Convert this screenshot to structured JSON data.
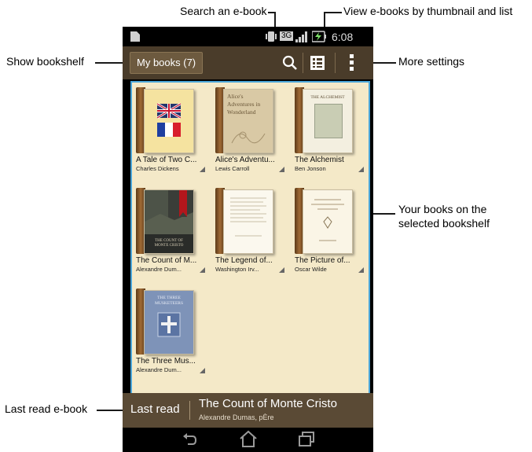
{
  "callouts": {
    "search": "Search an e-book",
    "view": "View e-books by thumbnail and list",
    "bookshelf": "Show bookshelf",
    "more": "More settings",
    "yourbooks_1": "Your books on the",
    "yourbooks_2": "selected bookshelf",
    "lastread": "Last read e-book"
  },
  "status": {
    "time": "6:08",
    "network": "3G"
  },
  "appbar": {
    "mybooks_label": "My books (7)"
  },
  "books": [
    {
      "title": "A Tale of Two C...",
      "author": "Charles Dickens"
    },
    {
      "title": "Alice's Adventu...",
      "author": "Lewis Carroll",
      "cover_text": "Alice's Adventures in Wonderland"
    },
    {
      "title": "The Alchemist",
      "author": "Ben Jonson",
      "cover_text": "THE ALCHEMIST"
    },
    {
      "title": "The Count of M...",
      "author": "Alexandre Dum...",
      "cover_text": "THE COUNT OF MONTE CRISTO"
    },
    {
      "title": "The Legend of...",
      "author": "Washington Irv..."
    },
    {
      "title": "The Picture of...",
      "author": "Oscar Wilde"
    },
    {
      "title": "The Three Mus...",
      "author": "Alexandre Dum...",
      "cover_text": "THE THREE MUSKETEERS"
    }
  ],
  "lastread": {
    "label": "Last read",
    "title": "The Count of Monte Cristo",
    "author": "Alexandre Dumas, pÈre"
  },
  "colors": {
    "appbar": "#4a3c2a",
    "shelf": "#f4e9c8",
    "selection": "#4aa6d9",
    "lastread": "#5a4a35"
  },
  "icons": [
    "search-icon",
    "list-view-icon",
    "overflow-menu-icon",
    "back-icon",
    "home-icon",
    "recent-apps-icon",
    "battery-icon",
    "signal-icon"
  ]
}
